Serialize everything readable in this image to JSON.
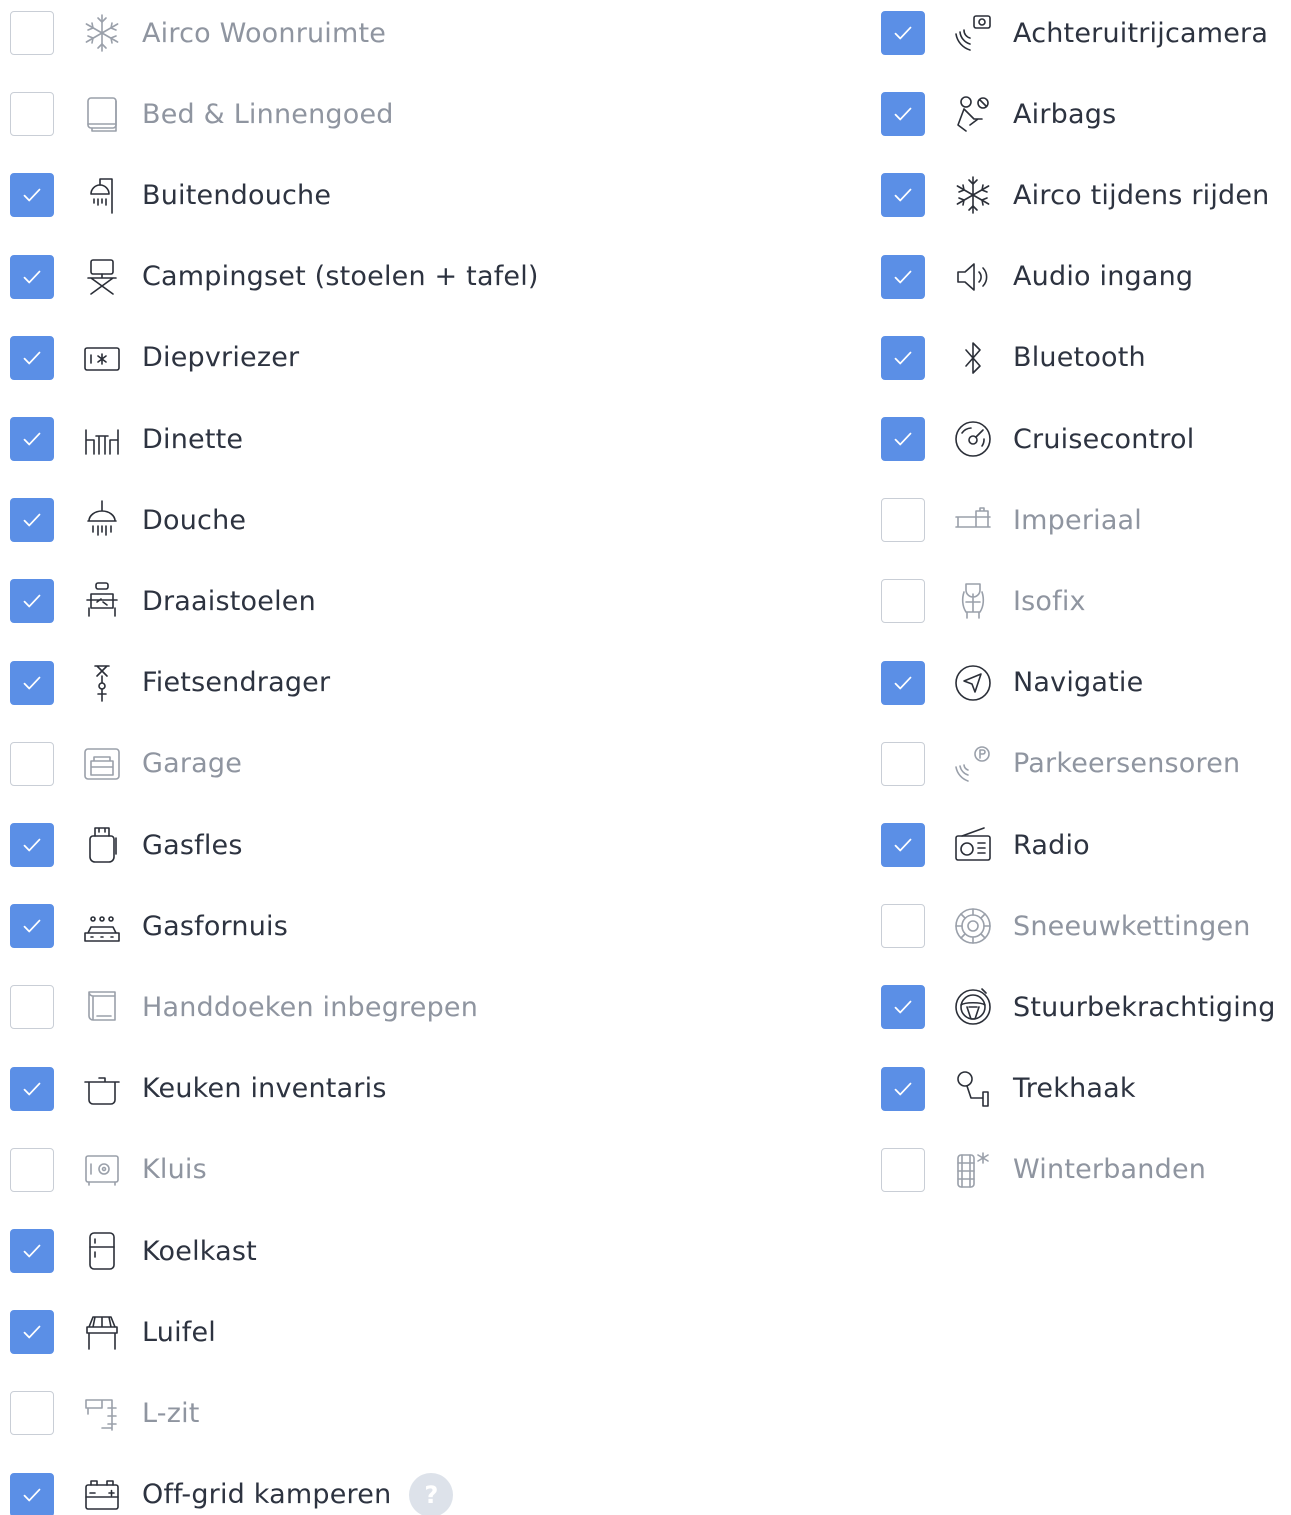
{
  "colors": {
    "checked": "#5b8fe6",
    "unchecked_border": "#c9ced6",
    "label_on": "#2d3340",
    "label_off": "#8f95a0"
  },
  "left": [
    {
      "label": "Airco Woonruimte",
      "checked": false,
      "icon": "snowflake-icon"
    },
    {
      "label": "Bed & Linnengoed",
      "checked": false,
      "icon": "bedding-icon"
    },
    {
      "label": "Buitendouche",
      "checked": true,
      "icon": "outdoor-shower-icon"
    },
    {
      "label": "Campingset (stoelen + tafel)",
      "checked": true,
      "icon": "camping-chair-icon"
    },
    {
      "label": "Diepvriezer",
      "checked": true,
      "icon": "freezer-icon"
    },
    {
      "label": "Dinette",
      "checked": true,
      "icon": "dinette-icon"
    },
    {
      "label": "Douche",
      "checked": true,
      "icon": "shower-icon"
    },
    {
      "label": "Draaistoelen",
      "checked": true,
      "icon": "swivel-seat-icon"
    },
    {
      "label": "Fietsendrager",
      "checked": true,
      "icon": "bike-rack-icon"
    },
    {
      "label": "Garage",
      "checked": false,
      "icon": "garage-icon"
    },
    {
      "label": "Gasfles",
      "checked": true,
      "icon": "gas-bottle-icon"
    },
    {
      "label": "Gasfornuis",
      "checked": true,
      "icon": "gas-stove-icon"
    },
    {
      "label": "Handdoeken inbegrepen",
      "checked": false,
      "icon": "towel-icon"
    },
    {
      "label": "Keuken inventaris",
      "checked": true,
      "icon": "cooking-pot-icon"
    },
    {
      "label": "Kluis",
      "checked": false,
      "icon": "safe-icon"
    },
    {
      "label": "Koelkast",
      "checked": true,
      "icon": "fridge-icon"
    },
    {
      "label": "Luifel",
      "checked": true,
      "icon": "awning-icon"
    },
    {
      "label": "L-zit",
      "checked": false,
      "icon": "l-seat-icon"
    },
    {
      "label": "Off-grid kamperen",
      "checked": true,
      "icon": "battery-icon",
      "help": "?"
    }
  ],
  "right": [
    {
      "label": "Achteruitrijcamera",
      "checked": true,
      "icon": "rear-camera-icon"
    },
    {
      "label": "Airbags",
      "checked": true,
      "icon": "airbag-icon"
    },
    {
      "label": "Airco tijdens rijden",
      "checked": true,
      "icon": "snowflake-icon"
    },
    {
      "label": "Audio ingang",
      "checked": true,
      "icon": "speaker-icon"
    },
    {
      "label": "Bluetooth",
      "checked": true,
      "icon": "bluetooth-icon"
    },
    {
      "label": "Cruisecontrol",
      "checked": true,
      "icon": "speedometer-icon"
    },
    {
      "label": "Imperiaal",
      "checked": false,
      "icon": "roof-rack-icon"
    },
    {
      "label": "Isofix",
      "checked": false,
      "icon": "child-seat-icon"
    },
    {
      "label": "Navigatie",
      "checked": true,
      "icon": "navigation-icon"
    },
    {
      "label": "Parkeersensoren",
      "checked": false,
      "icon": "parking-sensor-icon"
    },
    {
      "label": "Radio",
      "checked": true,
      "icon": "radio-icon"
    },
    {
      "label": "Sneeuwkettingen",
      "checked": false,
      "icon": "snow-chain-icon"
    },
    {
      "label": "Stuurbekrachtiging",
      "checked": true,
      "icon": "steering-wheel-icon"
    },
    {
      "label": "Trekhaak",
      "checked": true,
      "icon": "tow-hitch-icon"
    },
    {
      "label": "Winterbanden",
      "checked": false,
      "icon": "winter-tire-icon"
    }
  ]
}
